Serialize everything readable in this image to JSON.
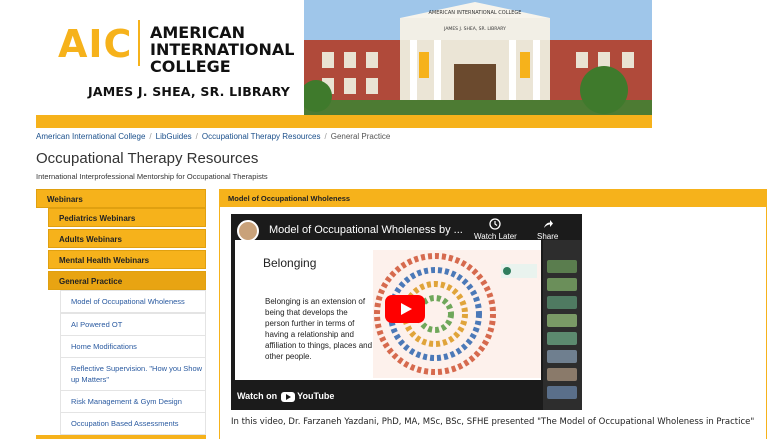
{
  "header": {
    "logo_mark": "AIC",
    "college_name_lines": [
      "AMERICAN",
      "INTERNATIONAL",
      "COLLEGE"
    ],
    "library_name": "JAMES J. SHEA, SR. LIBRARY",
    "building_sign_top": "AMERICAN INTERNATIONAL COLLEGE",
    "building_sign_bottom": "JAMES J. SHEA, SR. LIBRARY",
    "brand_color": "#f6b21b"
  },
  "breadcrumb": {
    "items": [
      "American International College",
      "LibGuides",
      "Occupational Therapy Resources",
      "General Practice"
    ],
    "separator": "/"
  },
  "page": {
    "title": "Occupational Therapy Resources",
    "subtitle": "International Interprofessional Mentorship for Occupational Therapists"
  },
  "sidebar": {
    "top_item": "Webinars",
    "sub_items": [
      "Pediatrics Webinars",
      "Adults Webinars",
      "Mental Health Webinars",
      "General Practice"
    ],
    "active_sub_item": "General Practice",
    "leaf_items": [
      "Model of Occupational Wholeness",
      "AI Powered OT",
      "Home Modifications",
      "Reflective Supervision. \"How you Show up Matters\"",
      "Risk Management & Gym Design",
      "Occupation Based Assessments"
    ]
  },
  "panel": {
    "header": "Model of Occupational Wholeness",
    "video": {
      "title": "Model of Occupational Wholeness by ...",
      "watch_later_label": "Watch Later",
      "share_label": "Share",
      "slide_title": "Belonging",
      "slide_body": "Belonging is an extension of being that develops the person further in terms of having a relationship and affiliation to things, places and other people.",
      "watch_on_label": "Watch on",
      "youtube_label": "YouTube",
      "play_icon": "youtube-play-icon"
    },
    "description": "In this video, Dr. Farzaneh Yazdani, PhD, MA, MSc, BSc, SFHE presented \"The Model of Occupational Wholeness in Practice\""
  }
}
